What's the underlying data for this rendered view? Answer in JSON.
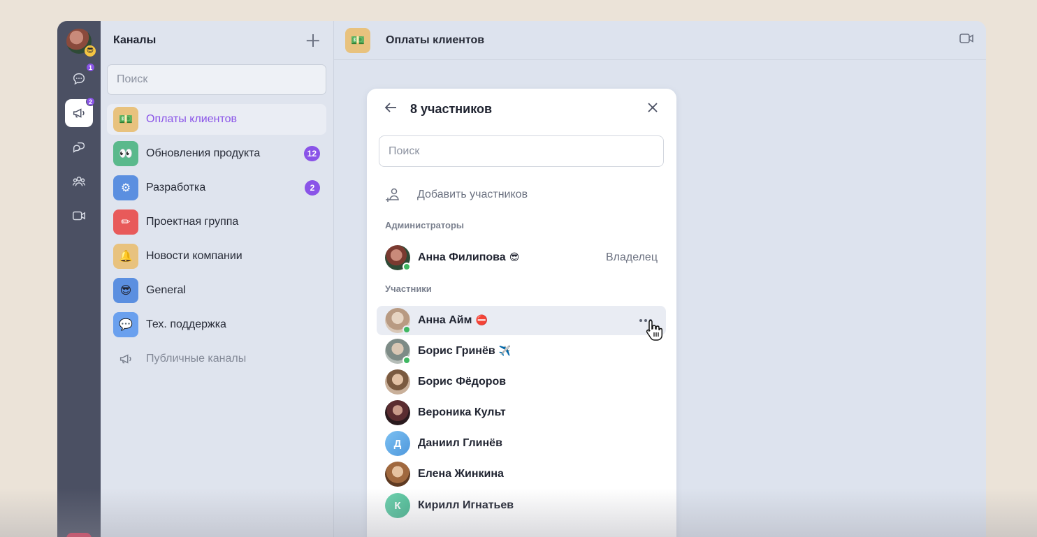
{
  "rail": {
    "items": [
      {
        "name": "chats",
        "icon": "chat-bubble-icon",
        "badge": "1"
      },
      {
        "name": "channels",
        "icon": "megaphone-icon",
        "badge": "2",
        "active": true
      },
      {
        "name": "threads",
        "icon": "threads-icon"
      },
      {
        "name": "contacts",
        "icon": "people-icon"
      },
      {
        "name": "calls",
        "icon": "video-camera-icon"
      }
    ]
  },
  "channels": {
    "title": "Каналы",
    "search_placeholder": "Поиск",
    "items": [
      {
        "name": "Оплаты клиентов",
        "icon": "money-icon",
        "color": "#e8c27e",
        "glyph": "💵",
        "active": true
      },
      {
        "name": "Обновления продукта",
        "icon": "eyes-icon",
        "color": "#5ab98c",
        "glyph": "👀",
        "badge": "12"
      },
      {
        "name": "Разработка",
        "icon": "gear-icon",
        "color": "#5b8fe0",
        "glyph": "⚙",
        "badge": "2"
      },
      {
        "name": "Проектная группа",
        "icon": "pencil-icon",
        "color": "#e85a5a",
        "glyph": "✏"
      },
      {
        "name": "Новости компании",
        "icon": "bell-icon",
        "color": "#e8c27e",
        "glyph": "🔔"
      },
      {
        "name": "General",
        "icon": "cool-face-icon",
        "color": "#5b8fe0",
        "glyph": "😎"
      },
      {
        "name": "Тех. поддержка",
        "icon": "speech-bubble-icon",
        "color": "#6aa0ee",
        "glyph": "💬"
      }
    ],
    "public_label": "Публичные каналы"
  },
  "main": {
    "title": "Оплаты клиентов",
    "glyph": "💵"
  },
  "panel": {
    "title": "8 участников",
    "search_placeholder": "Поиск",
    "add_label": "Добавить участников",
    "admins_label": "Администраторы",
    "members_label": "Участники",
    "owner": {
      "name": "Анна Филипова",
      "emoji": "😎",
      "role": "Владелец"
    },
    "members": [
      {
        "name": "Анна Айм",
        "emoji": "⛔",
        "online": true,
        "avatar": "photo",
        "color": "#c9b7a6"
      },
      {
        "name": "Борис Гринёв",
        "emoji": "✈️",
        "online": true,
        "avatar": "photo",
        "color": "#9aa4a0"
      },
      {
        "name": "Борис Фёдоров",
        "emoji": "",
        "online": false,
        "avatar": "photo",
        "color": "#a88a6e"
      },
      {
        "name": "Вероника Культ",
        "emoji": "",
        "online": false,
        "avatar": "photo",
        "color": "#4a2c30"
      },
      {
        "name": "Даниил Глинёв",
        "emoji": "",
        "online": false,
        "avatar": "Д",
        "color": "#6ab0ea"
      },
      {
        "name": "Елена Жинкина",
        "emoji": "",
        "online": false,
        "avatar": "photo",
        "color": "#b07a4e"
      },
      {
        "name": "Кирилл Игнатьев",
        "emoji": "",
        "online": false,
        "avatar": "К",
        "color": "#5cc3a0"
      }
    ]
  }
}
